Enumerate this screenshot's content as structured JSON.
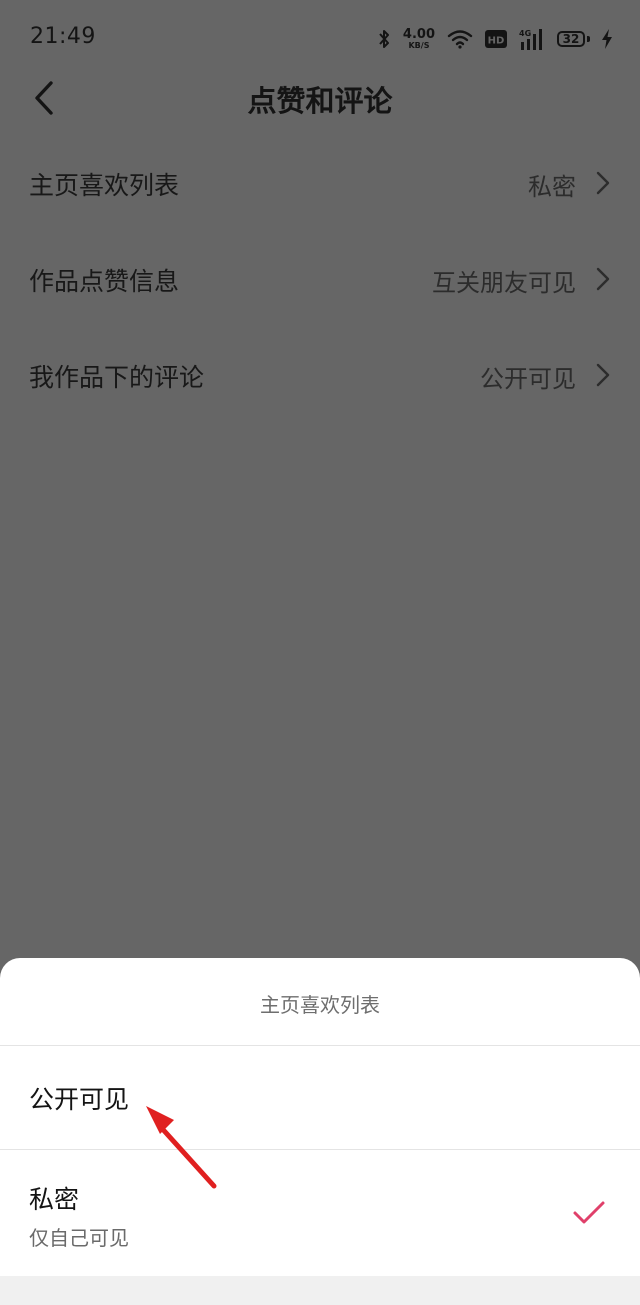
{
  "status_bar": {
    "time": "21:49",
    "net_speed_value": "4.00",
    "net_speed_unit": "KB/S",
    "hd_label": "HD",
    "network_label": "4G",
    "battery_level": "32",
    "icons": [
      "bluetooth-icon",
      "wifi-icon",
      "hd-icon",
      "signal-icon",
      "battery-icon",
      "charging-icon"
    ]
  },
  "header": {
    "title": "点赞和评论",
    "back_icon": "chevron-left-icon"
  },
  "settings": {
    "items": [
      {
        "label": "主页喜欢列表",
        "value": "私密"
      },
      {
        "label": "作品点赞信息",
        "value": "互关朋友可见"
      },
      {
        "label": "我作品下的评论",
        "value": "公开可见"
      }
    ]
  },
  "sheet": {
    "title": "主页喜欢列表",
    "options": [
      {
        "label": "公开可见",
        "sub": "",
        "selected": false
      },
      {
        "label": "私密",
        "sub": "仅自己可见",
        "selected": true
      }
    ],
    "check_color": "#e0406a"
  },
  "colors": {
    "overlay_background": "#666666",
    "annotation_arrow": "#e02020"
  }
}
